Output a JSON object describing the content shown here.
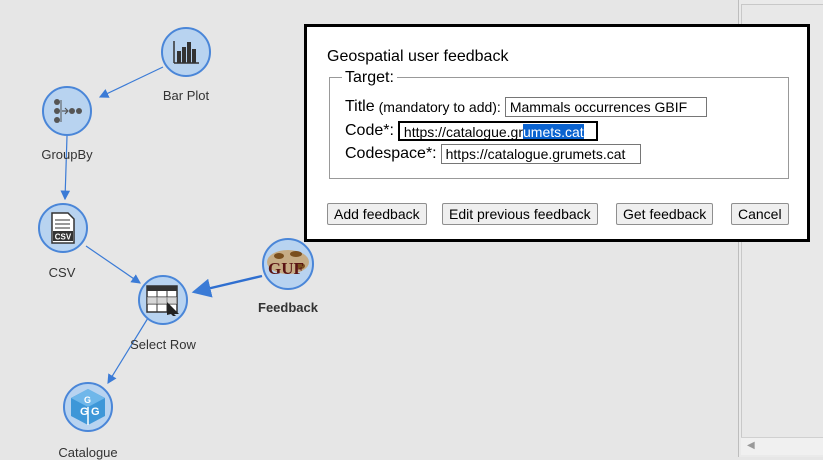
{
  "workflow": {
    "nodes": [
      {
        "id": "bar-plot",
        "label": "Bar Plot",
        "icon": "bar-chart-icon"
      },
      {
        "id": "groupby",
        "label": "GroupBy",
        "icon": "group-nodes-icon"
      },
      {
        "id": "csv",
        "label": "CSV",
        "icon": "csv-document-icon",
        "icon_text": "CSV"
      },
      {
        "id": "select-row",
        "label": "Select Row",
        "icon": "table-cursor-icon"
      },
      {
        "id": "feedback",
        "label": "Feedback",
        "icon": "guf-logo-icon",
        "icon_text": "GUF"
      },
      {
        "id": "catalogue",
        "label": "Catalogue",
        "icon": "catalogue-cube-icon"
      }
    ]
  },
  "dialog": {
    "title": "Geospatial user feedback",
    "fieldset_legend": "Target:",
    "title_field": {
      "label": "Title",
      "hint": "(mandatory to add):",
      "value": "Mammals occurrences GBIF"
    },
    "code_field": {
      "label": "Code*:",
      "value_before_selection": "https://catalogue.gr",
      "value_selected": "umets.cat"
    },
    "codespace_field": {
      "label": "Codespace*:",
      "value": "https://catalogue.grumets.cat"
    },
    "buttons": {
      "add": "Add feedback",
      "edit": "Edit previous feedback",
      "get": "Get feedback",
      "cancel": "Cancel"
    }
  },
  "colors": {
    "node_fill": "#b8d3f0",
    "node_border": "#4a86d8",
    "edge": "#3b7bd6",
    "selection": "#0a63d0"
  }
}
